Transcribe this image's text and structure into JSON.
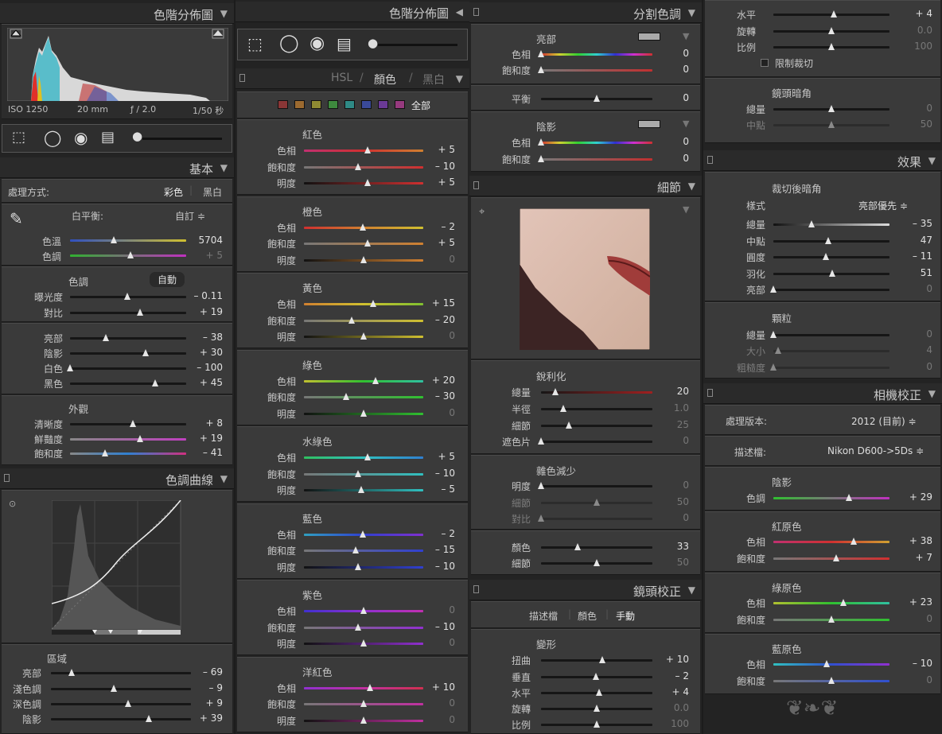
{
  "col1": {
    "histogram": {
      "title": "色階分佈圖",
      "iso": "ISO 1250",
      "focal": "20 mm",
      "aperture": "ƒ / 2.0",
      "shutter": "1/50 秒"
    },
    "basic": {
      "title": "基本",
      "treatment_label": "處理方式:",
      "color_btn": "彩色",
      "bw_btn": "黑白",
      "wb_label": "白平衡:",
      "wb_value": "自訂 ≑",
      "temp_label": "色溫",
      "temp_value": "5704",
      "tint_label": "色調",
      "tint_value": "+ 5",
      "tone_label": "色調",
      "auto_btn": "自動",
      "exposure_label": "曝光度",
      "exposure_value": "– 0.11",
      "contrast_label": "對比",
      "contrast_value": "+ 19",
      "highlights_label": "亮部",
      "highlights_value": "– 38",
      "shadows_label": "陰影",
      "shadows_value": "+ 30",
      "whites_label": "白色",
      "whites_value": "– 100",
      "blacks_label": "黑色",
      "blacks_value": "+ 45",
      "presence_label": "外觀",
      "clarity_label": "清晰度",
      "clarity_value": "+ 8",
      "vibrance_label": "鮮豔度",
      "vibrance_value": "+ 19",
      "saturation_label": "飽和度",
      "saturation_value": "– 41"
    },
    "tonecurve": {
      "title": "色調曲線",
      "region_label": "區域",
      "highlights_label": "亮部",
      "highlights_value": "– 69",
      "lights_label": "淺色調",
      "lights_value": "– 9",
      "darks_label": "深色調",
      "darks_value": "+ 9",
      "shadows_label": "陰影",
      "shadows_value": "+ 39"
    }
  },
  "col2": {
    "header": "色階分佈圖",
    "hsl": {
      "tab_hsl": "HSL",
      "tab_color": "顏色",
      "tab_bw": "黑白",
      "all_label": "全部",
      "groups": [
        {
          "name": "紅色",
          "rows": [
            {
              "l": "色相",
              "v": "+ 5"
            },
            {
              "l": "飽和度",
              "v": "– 10"
            },
            {
              "l": "明度",
              "v": "+ 5"
            }
          ]
        },
        {
          "name": "橙色",
          "rows": [
            {
              "l": "色相",
              "v": "– 2"
            },
            {
              "l": "飽和度",
              "v": "+ 5"
            },
            {
              "l": "明度",
              "v": "0"
            }
          ]
        },
        {
          "name": "黃色",
          "rows": [
            {
              "l": "色相",
              "v": "+ 15"
            },
            {
              "l": "飽和度",
              "v": "– 20"
            },
            {
              "l": "明度",
              "v": "0"
            }
          ]
        },
        {
          "name": "綠色",
          "rows": [
            {
              "l": "色相",
              "v": "+ 20"
            },
            {
              "l": "飽和度",
              "v": "– 30"
            },
            {
              "l": "明度",
              "v": "0"
            }
          ]
        },
        {
          "name": "水綠色",
          "rows": [
            {
              "l": "色相",
              "v": "+ 5"
            },
            {
              "l": "飽和度",
              "v": "– 10"
            },
            {
              "l": "明度",
              "v": "– 5"
            }
          ]
        },
        {
          "name": "藍色",
          "rows": [
            {
              "l": "色相",
              "v": "– 2"
            },
            {
              "l": "飽和度",
              "v": "– 15"
            },
            {
              "l": "明度",
              "v": "– 10"
            }
          ]
        },
        {
          "name": "紫色",
          "rows": [
            {
              "l": "色相",
              "v": "0"
            },
            {
              "l": "飽和度",
              "v": "– 10"
            },
            {
              "l": "明度",
              "v": "0"
            }
          ]
        },
        {
          "name": "洋紅色",
          "rows": [
            {
              "l": "色相",
              "v": "+ 10"
            },
            {
              "l": "飽和度",
              "v": "0"
            },
            {
              "l": "明度",
              "v": "0"
            }
          ]
        }
      ]
    }
  },
  "col3": {
    "split": {
      "title": "分割色調",
      "hl_label": "亮部",
      "hue_label": "色相",
      "sat_label": "飽和度",
      "hl_hue": "0",
      "hl_sat": "0",
      "balance_label": "平衡",
      "balance_value": "0",
      "sh_label": "陰影",
      "sh_hue": "0",
      "sh_sat": "0"
    },
    "detail": {
      "title": "細節",
      "sharpen_label": "銳利化",
      "amount_label": "總量",
      "amount_value": "20",
      "radius_label": "半徑",
      "radius_value": "1.0",
      "detail_label": "細節",
      "detail_value": "25",
      "masking_label": "遮色片",
      "masking_value": "0",
      "nr_label": "雜色減少",
      "lum_label": "明度",
      "lum_value": "0",
      "lum_detail_label": "細節",
      "lum_detail_value": "50",
      "contrast_label": "對比",
      "contrast_value": "0",
      "color_label": "顏色",
      "color_value": "33",
      "color_detail_label": "細節",
      "color_detail_value": "50"
    },
    "lens": {
      "title": "鏡頭校正",
      "tab_profile": "描述檔",
      "tab_color": "顏色",
      "tab_manual": "手動",
      "transform_label": "變形",
      "distortion_label": "扭曲",
      "distortion_value": "+ 10",
      "vertical_label": "垂直",
      "vertical_value": "– 2",
      "horizontal_label": "水平",
      "horizontal_value": "+ 4",
      "rotate_label": "旋轉",
      "rotate_value": "0.0",
      "scale_label": "比例",
      "scale_value": "100"
    }
  },
  "col4": {
    "top": {
      "horizontal_label": "水平",
      "horizontal_value": "+ 4",
      "rotate_label": "旋轉",
      "rotate_value": "0.0",
      "scale_label": "比例",
      "scale_value": "100",
      "constrain_label": "限制裁切",
      "vignette_label": "鏡頭暗角",
      "amount_label": "總量",
      "amount_value": "0",
      "midpoint_label": "中點",
      "midpoint_value": "50"
    },
    "effects": {
      "title": "效果",
      "pcv_label": "裁切後暗角",
      "style_label": "樣式",
      "style_value": "亮部優先 ≑",
      "amount_label": "總量",
      "amount_value": "– 35",
      "midpoint_label": "中點",
      "midpoint_value": "47",
      "roundness_label": "圓度",
      "roundness_value": "– 11",
      "feather_label": "羽化",
      "feather_value": "51",
      "highlights_label": "亮部",
      "highlights_value": "0",
      "grain_label": "顆粒",
      "g_amount_label": "總量",
      "g_amount_value": "0",
      "size_label": "大小",
      "size_value": "4",
      "rough_label": "粗糙度",
      "rough_value": "0"
    },
    "camera": {
      "title": "相機校正",
      "process_label": "處理版本:",
      "process_value": "2012 (目前) ≑",
      "profile_label": "描述檔:",
      "profile_value": "Nikon D600->5Ds ≑",
      "shadows_label": "陰影",
      "tint_label": "色調",
      "tint_value": "+ 29",
      "red_label": "紅原色",
      "red_hue_label": "色相",
      "red_hue_value": "+ 38",
      "red_sat_label": "飽和度",
      "red_sat_value": "+ 7",
      "green_label": "綠原色",
      "green_hue_label": "色相",
      "green_hue_value": "+ 23",
      "green_sat_label": "飽和度",
      "green_sat_value": "0",
      "blue_label": "藍原色",
      "blue_hue_label": "色相",
      "blue_hue_value": "– 10",
      "blue_sat_label": "飽和度",
      "blue_sat_value": "0"
    }
  },
  "colors": {
    "panel_bg": "#3a3a3a",
    "header_bg": "#2a2a2a",
    "text": "#c7c7c7",
    "value": "#e0e0e0"
  },
  "sliders": {
    "temp": 0.38,
    "tint": 0.52,
    "exposure": 0.49,
    "contrast": 0.6,
    "highlights": 0.31,
    "shadows": 0.65,
    "whites": 0.0,
    "blacks": 0.73,
    "clarity": 0.54,
    "vibrance": 0.6,
    "saturation": 0.3,
    "tc_highlights": 0.15,
    "tc_lights": 0.45,
    "tc_darks": 0.55,
    "tc_shadows": 0.7,
    "hsl": [
      [
        0.53,
        0.45,
        0.53
      ],
      [
        0.49,
        0.53,
        0.5
      ],
      [
        0.58,
        0.4,
        0.5
      ],
      [
        0.6,
        0.35,
        0.5
      ],
      [
        0.53,
        0.45,
        0.48
      ],
      [
        0.49,
        0.43,
        0.45
      ],
      [
        0.5,
        0.45,
        0.5
      ],
      [
        0.55,
        0.5,
        0.5
      ]
    ],
    "split": [
      0.0,
      0.0,
      0.5,
      0.0,
      0.0
    ],
    "detail": [
      0.13,
      0.2,
      0.25,
      0.0,
      0.0,
      0.5,
      0.0,
      0.33,
      0.5
    ],
    "lens": [
      0.55,
      0.49,
      0.52,
      0.5,
      0.5
    ],
    "c4top": [
      0.52,
      0.5,
      0.5,
      0.5,
      0.5
    ],
    "effects": [
      0.33,
      0.47,
      0.45,
      0.51,
      0.0,
      0.0,
      0.04,
      0.0
    ],
    "camera": [
      0.65,
      0.69,
      0.54,
      0.6,
      0.5,
      0.46,
      0.5
    ]
  }
}
